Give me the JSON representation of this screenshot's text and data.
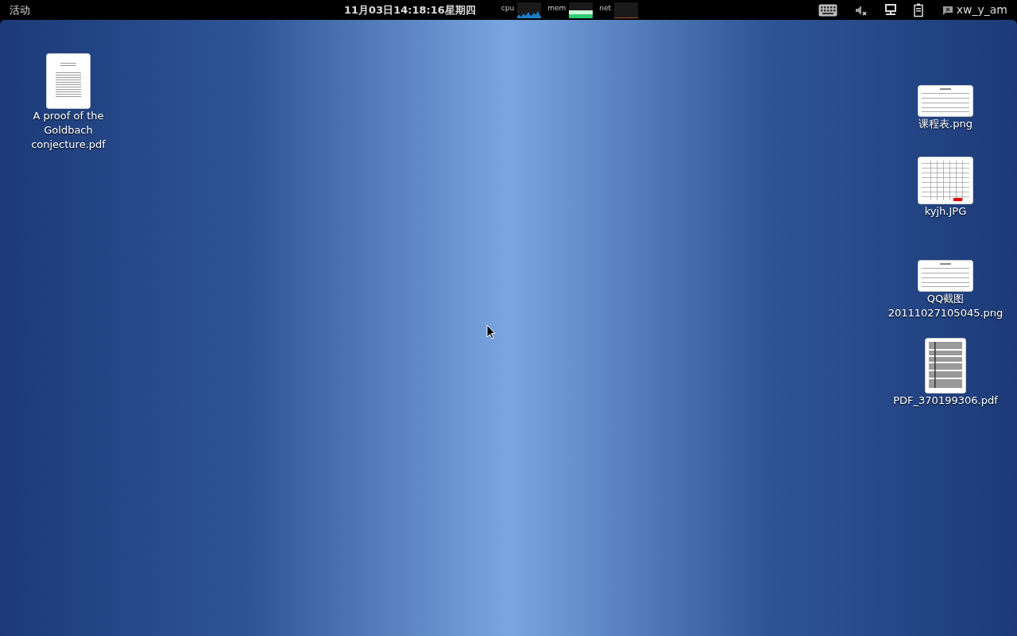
{
  "top_bar": {
    "activities": "活动",
    "clock": "11月03日14:18:16星期四",
    "monitors": [
      {
        "label": "cpu",
        "kind": "cpu"
      },
      {
        "label": "mem",
        "kind": "mem"
      },
      {
        "label": "net",
        "kind": "net"
      }
    ],
    "user": "xw_y_am"
  },
  "desktop_left": [
    {
      "label": "A proof of the Goldbach conjecture.pdf",
      "kind": "paper"
    }
  ],
  "desktop_right": [
    {
      "label": "课程表.png",
      "kind": "wide"
    },
    {
      "label": "kyjh.JPG",
      "kind": "table"
    },
    {
      "label": "QQ截图 20111027105045.png",
      "kind": "wide"
    },
    {
      "label": "PDF_370199306.pdf",
      "kind": "form"
    }
  ]
}
